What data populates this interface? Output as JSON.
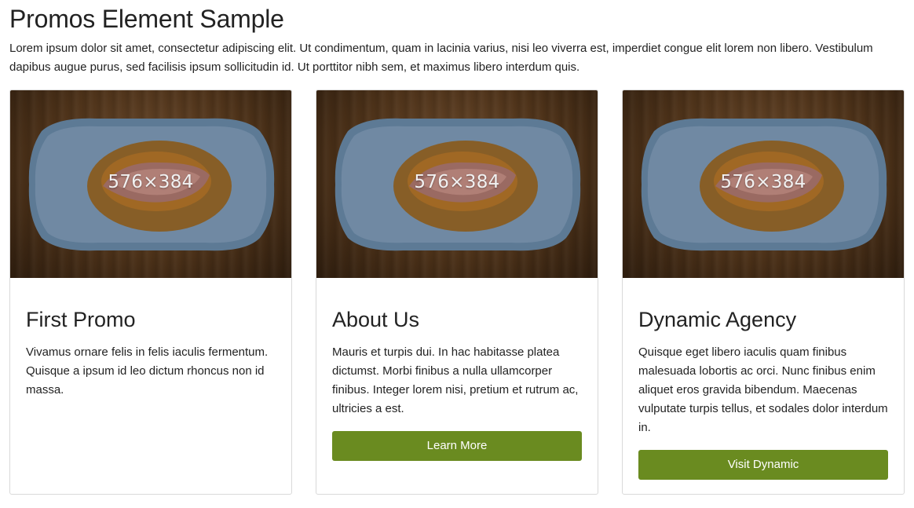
{
  "page": {
    "title": "Promos Element Sample",
    "intro": "Lorem ipsum dolor sit amet, consectetur adipiscing elit. Ut condimentum, quam in lacinia varius, nisi leo viverra est, imperdiet congue elit lorem non libero. Vestibulum dapibus augue purus, sed facilisis ipsum sollicitudin id. Ut porttitor nibh sem, et maximus libero interdum quis."
  },
  "colors": {
    "button_bg": "#6a8b20",
    "text": "#222222",
    "card_border": "#d9d9d9"
  },
  "promos": [
    {
      "image_label": "576×384",
      "title": "First Promo",
      "text": "Vivamus ornare felis in felis iaculis fermentum. Quisque a ipsum id leo dictum rhoncus non id massa.",
      "button": ""
    },
    {
      "image_label": "576×384",
      "title": "About Us",
      "text": "Mauris et turpis dui. In hac habitasse platea dictumst. Morbi finibus a nulla ullamcorper finibus. Integer lorem nisi, pretium et rutrum ac, ultricies a est.",
      "button": "Learn More"
    },
    {
      "image_label": "576×384",
      "title": "Dynamic Agency",
      "text": "Quisque eget libero iaculis quam finibus malesuada lobortis ac orci. Nunc finibus enim aliquet eros gravida bibendum. Maecenas vulputate turpis tellus, et sodales dolor interdum in.",
      "button": "Visit Dynamic"
    }
  ]
}
